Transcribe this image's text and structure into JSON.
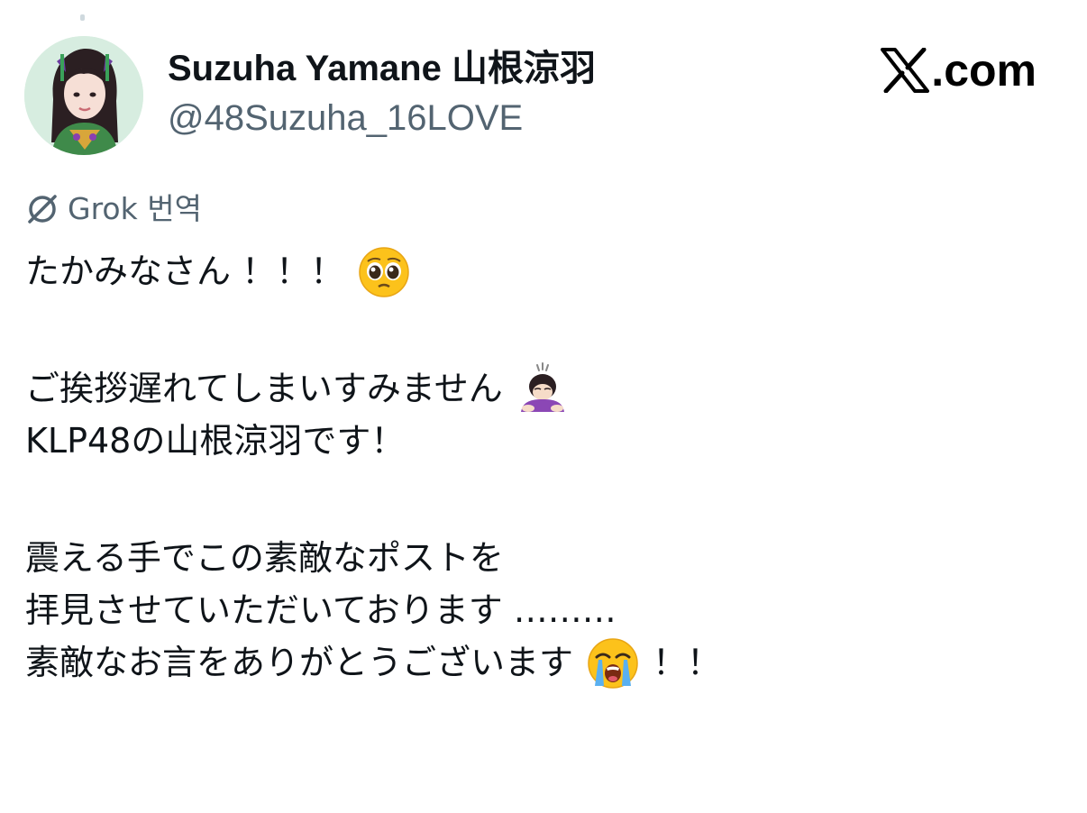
{
  "post": {
    "author": {
      "display_name": "Suzuha Yamane 山根涼羽",
      "handle": "@48Suzuha_16LOVE",
      "avatar": "profile-photo"
    },
    "brand": {
      "icon": "x-logo-icon",
      "label": ".com"
    },
    "translation": {
      "icon": "grok-icon",
      "label": "Grok 번역"
    },
    "lines": {
      "l1_text": "たかみなさん ！！！",
      "l1_emoji": "pleading-face-emoji",
      "l2_text": "ご挨拶遅れてしまいすみません",
      "l2_emoji": "person-bowing-emoji",
      "l3_text": "KLP48の山根涼羽です！",
      "l4_text": "震える手でこの素敵なポストを",
      "l5_text": "拝見させていただいております ………",
      "l6_text": "素敵なお言をありがとうございます",
      "l6_emoji": "loudly-crying-face-emoji",
      "l6_after": "！！"
    }
  }
}
